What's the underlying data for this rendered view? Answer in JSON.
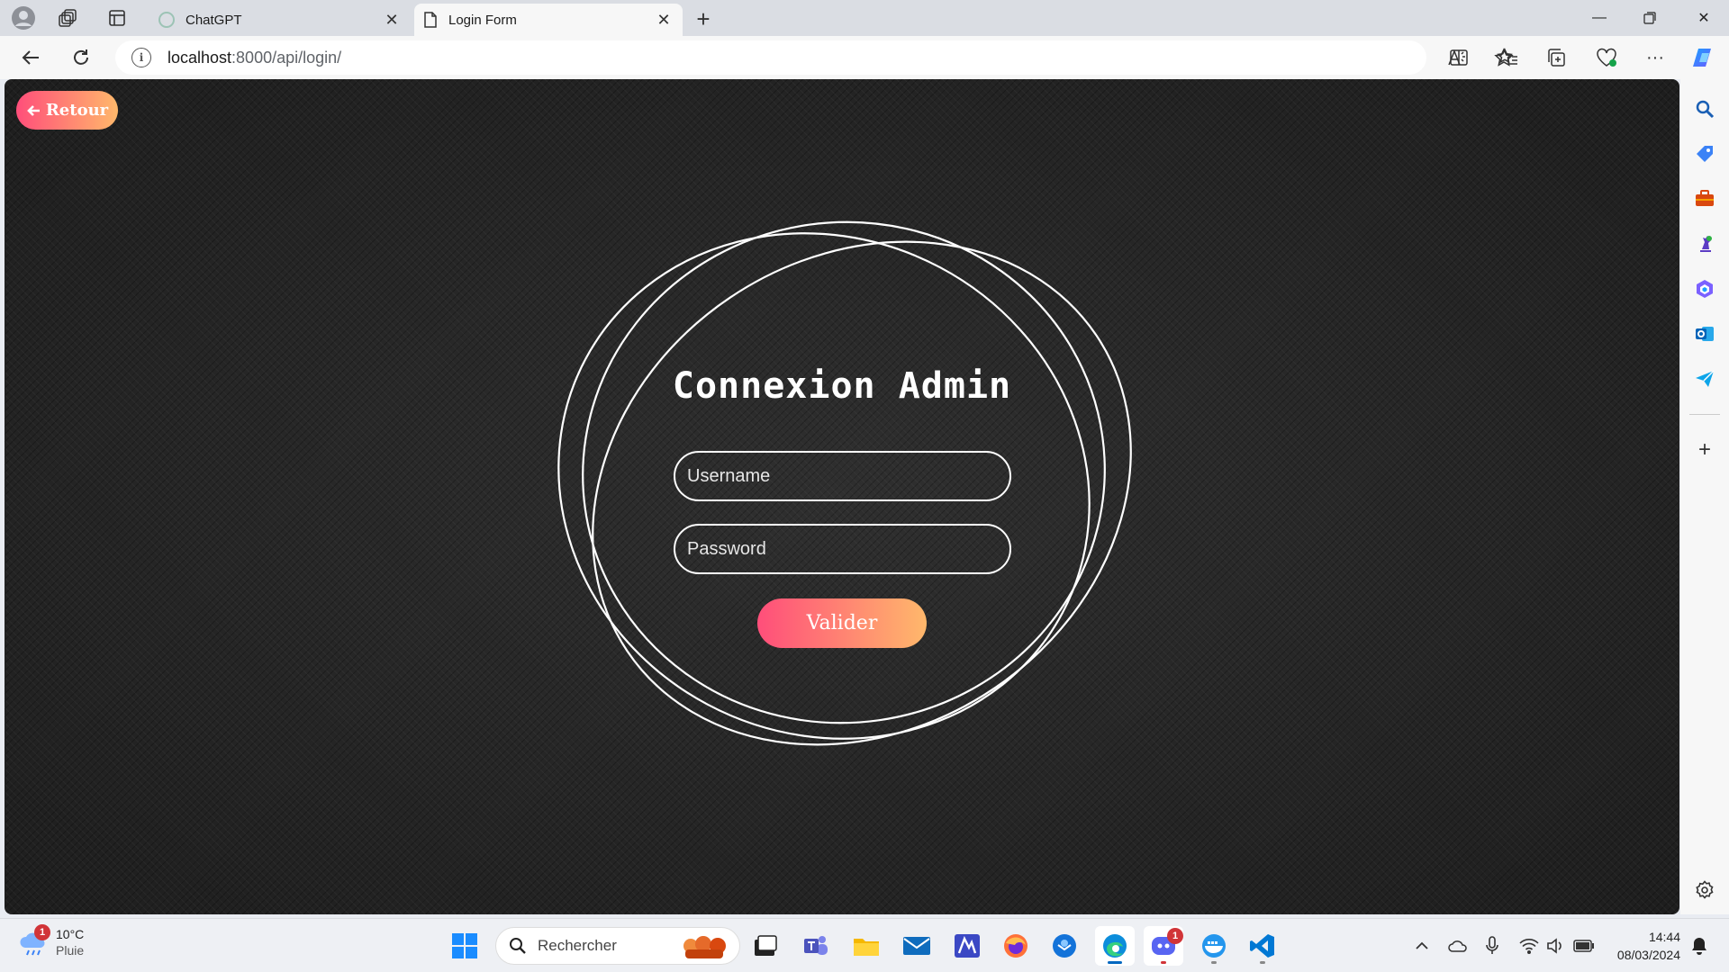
{
  "browser": {
    "tabs": [
      {
        "label": "ChatGPT",
        "active": false
      },
      {
        "label": "Login Form",
        "active": true
      }
    ],
    "url_host": "localhost",
    "url_path": ":8000/api/login/"
  },
  "page": {
    "back_label": "Retour",
    "title": "Connexion Admin",
    "username_placeholder": "Username",
    "password_placeholder": "Password",
    "submit_label": "Valider",
    "accent_gradient": [
      "#ff4e7a",
      "#ffb86b"
    ]
  },
  "taskbar": {
    "weather_badge": "1",
    "weather_temp": "10°C",
    "weather_desc": "Pluie",
    "search_placeholder": "Rechercher",
    "discord_badge": "1",
    "time": "14:44",
    "date": "08/03/2024"
  }
}
